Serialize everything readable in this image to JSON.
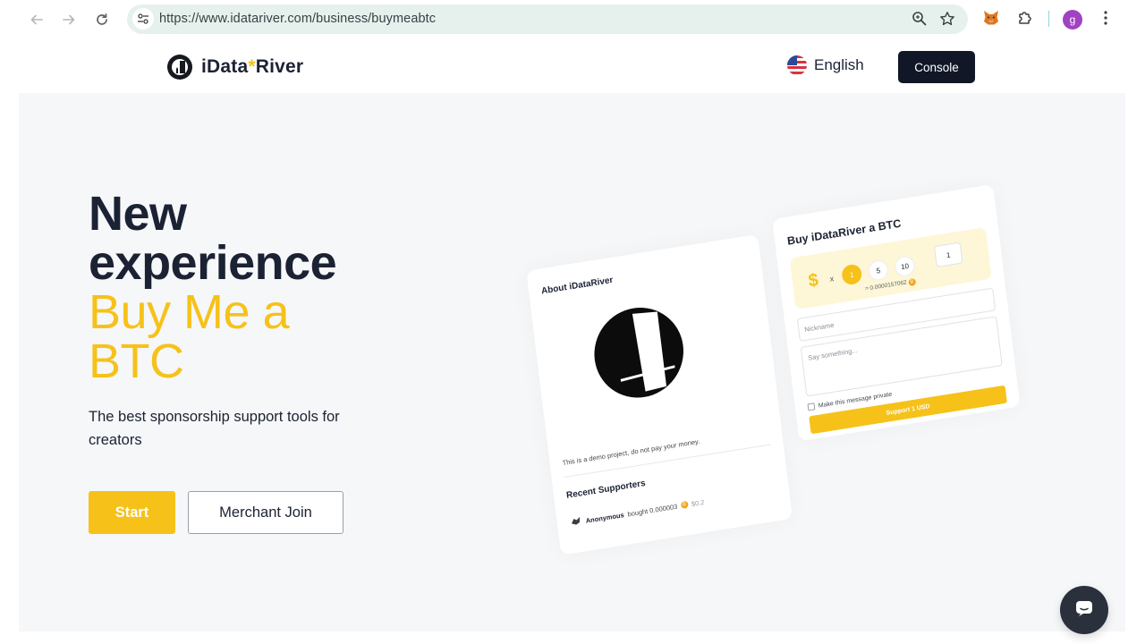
{
  "browser": {
    "url": "https://www.idatariver.com/business/buymeabtc",
    "profile_initial": "g"
  },
  "header": {
    "brand_main": "iData",
    "brand_star": "*",
    "brand_tail": "River",
    "language": "English",
    "console_label": "Console"
  },
  "hero": {
    "title_line1": "New",
    "title_line2": "experience",
    "accent_line1": "Buy Me a",
    "accent_line2": "BTC",
    "subtitle": "The best sponsorship support tools for creators",
    "start_label": "Start",
    "merchant_label": "Merchant Join"
  },
  "preview": {
    "about_title": "About iDataRiver",
    "demo_note": "This is a demo project, do not pay your money.",
    "recent_title": "Recent Supporters",
    "supporter_name": "Anonymous",
    "supporter_text": "bought 0.000003",
    "supporter_amount": "$0.2",
    "buy_title": "Buy iDataRiver a BTC",
    "currency_symbol": "$",
    "times": "x",
    "chip_1": "1",
    "chip_5": "5",
    "chip_10": "10",
    "quantity": "1",
    "btc_equivalent": "≈ 0.0000157062",
    "coin_symbol": "B",
    "nickname_placeholder": "Nickname",
    "message_placeholder": "Say something...",
    "private_label": "Make this message private",
    "support_button": "Support 1 USD"
  },
  "colors": {
    "accent": "#f6c21a",
    "dark": "#111726",
    "background": "#f6f7f9"
  },
  "icons": [
    "back-arrow-icon",
    "forward-arrow-icon",
    "reload-icon",
    "site-settings-icon",
    "zoom-icon",
    "bookmark-star-icon",
    "metamask-fox-icon",
    "extensions-puzzle-icon",
    "kebab-menu-icon",
    "us-flag-icon",
    "chat-icon"
  ]
}
